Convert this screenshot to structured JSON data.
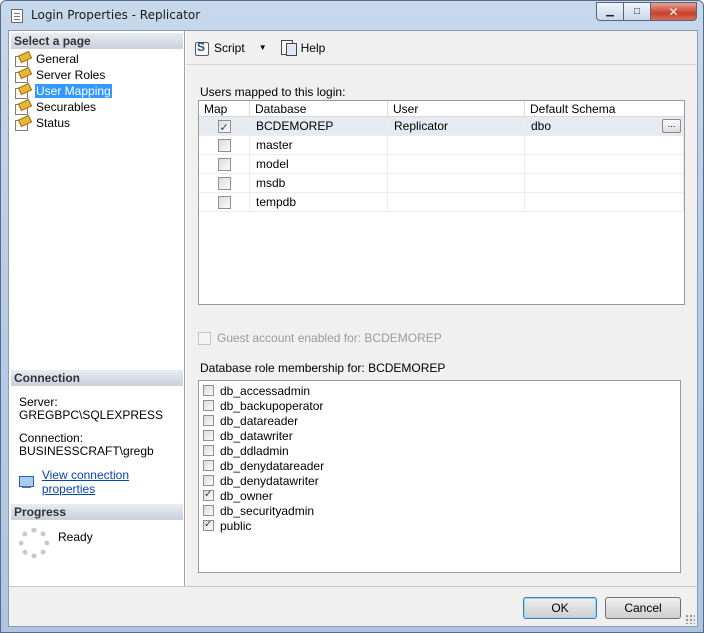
{
  "window": {
    "title": "Login Properties - Replicator",
    "icon": "document-icon",
    "minimize_glyph": "▁",
    "maximize_glyph": "□",
    "close_glyph": "✕"
  },
  "sidebar": {
    "select_page_header": "Select a page",
    "pages": [
      {
        "label": "General",
        "selected": false
      },
      {
        "label": "Server Roles",
        "selected": false
      },
      {
        "label": "User Mapping",
        "selected": true
      },
      {
        "label": "Securables",
        "selected": false
      },
      {
        "label": "Status",
        "selected": false
      }
    ],
    "connection_header": "Connection",
    "server_label": "Server:",
    "server_value": "GREGBPC\\SQLEXPRESS",
    "connection_label": "Connection:",
    "connection_value": "BUSINESSCRAFT\\gregb",
    "view_connection_link": "View connection properties",
    "progress_header": "Progress",
    "progress_status": "Ready"
  },
  "toolbar": {
    "script_label": "Script",
    "script_dropdown_glyph": "▼",
    "help_label": "Help"
  },
  "users_mapping": {
    "label": "Users mapped to this login:",
    "columns": [
      "Map",
      "Database",
      "User",
      "Default Schema"
    ],
    "rows": [
      {
        "mapped": true,
        "database": "BCDEMOREP",
        "user": "Replicator",
        "schema": "dbo",
        "selected": true
      },
      {
        "mapped": false,
        "database": "master",
        "user": "",
        "schema": "",
        "selected": false
      },
      {
        "mapped": false,
        "database": "model",
        "user": "",
        "schema": "",
        "selected": false
      },
      {
        "mapped": false,
        "database": "msdb",
        "user": "",
        "schema": "",
        "selected": false
      },
      {
        "mapped": false,
        "database": "tempdb",
        "user": "",
        "schema": "",
        "selected": false
      }
    ],
    "schema_browse_label": "..."
  },
  "guest": {
    "label": "Guest account enabled for: BCDEMOREP",
    "checked": false,
    "enabled": false
  },
  "roles": {
    "label": "Database role membership for: BCDEMOREP",
    "items": [
      {
        "name": "db_accessadmin",
        "checked": false
      },
      {
        "name": "db_backupoperator",
        "checked": false
      },
      {
        "name": "db_datareader",
        "checked": false
      },
      {
        "name": "db_datawriter",
        "checked": false
      },
      {
        "name": "db_ddladmin",
        "checked": false
      },
      {
        "name": "db_denydatareader",
        "checked": false
      },
      {
        "name": "db_denydatawriter",
        "checked": false
      },
      {
        "name": "db_owner",
        "checked": true
      },
      {
        "name": "db_securityadmin",
        "checked": false
      },
      {
        "name": "public",
        "checked": true
      }
    ]
  },
  "buttons": {
    "ok_label": "OK",
    "cancel_label": "Cancel"
  }
}
